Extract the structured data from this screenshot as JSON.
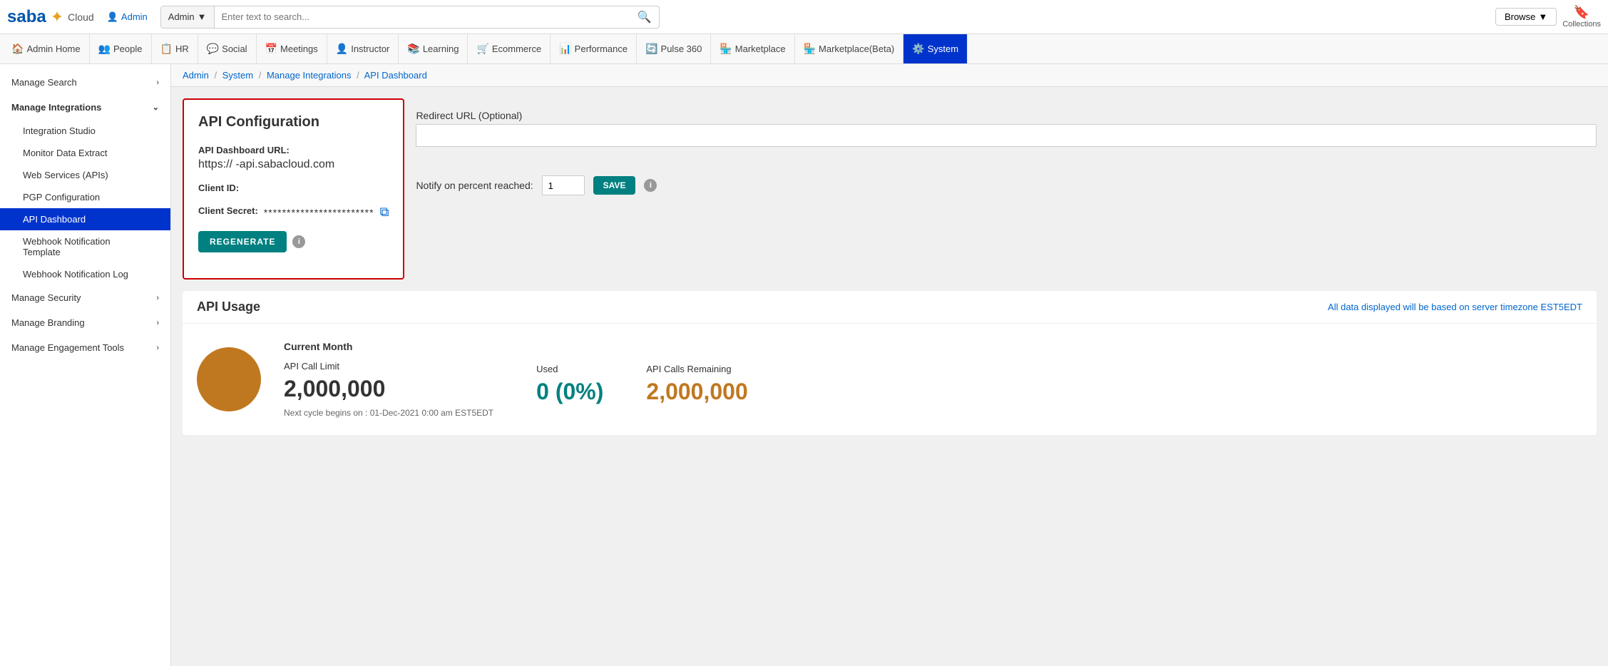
{
  "topbar": {
    "logo": "Saba Cloud",
    "admin_label": "Admin",
    "search_dropdown": "Admin",
    "search_placeholder": "Enter text to search...",
    "browse_label": "Browse",
    "collections_label": "Collections"
  },
  "navbar": {
    "items": [
      {
        "label": "Admin Home",
        "icon": "🏠",
        "active": false
      },
      {
        "label": "People",
        "icon": "👥",
        "active": false
      },
      {
        "label": "HR",
        "icon": "📋",
        "active": false
      },
      {
        "label": "Social",
        "icon": "💬",
        "active": false
      },
      {
        "label": "Meetings",
        "icon": "📅",
        "active": false
      },
      {
        "label": "Instructor",
        "icon": "👤",
        "active": false
      },
      {
        "label": "Learning",
        "icon": "📚",
        "active": false
      },
      {
        "label": "Ecommerce",
        "icon": "🛒",
        "active": false
      },
      {
        "label": "Performance",
        "icon": "📊",
        "active": false
      },
      {
        "label": "Pulse 360",
        "icon": "🔄",
        "active": false
      },
      {
        "label": "Marketplace",
        "icon": "🏪",
        "active": false
      },
      {
        "label": "Marketplace(Beta)",
        "icon": "🏪",
        "active": false
      },
      {
        "label": "System",
        "icon": "⚙️",
        "active": true
      }
    ]
  },
  "sidebar": {
    "items": [
      {
        "label": "Manage Search",
        "type": "parent",
        "expanded": false
      },
      {
        "label": "Manage Integrations",
        "type": "parent",
        "expanded": true
      },
      {
        "label": "Integration Studio",
        "type": "child",
        "active": false
      },
      {
        "label": "Monitor Data Extract",
        "type": "child",
        "active": false
      },
      {
        "label": "Web Services (APIs)",
        "type": "child",
        "active": false
      },
      {
        "label": "PGP Configuration",
        "type": "child",
        "active": false
      },
      {
        "label": "API Dashboard",
        "type": "child",
        "active": true
      },
      {
        "label": "Webhook Notification Template",
        "type": "child",
        "active": false
      },
      {
        "label": "Webhook Notification Log",
        "type": "child",
        "active": false
      },
      {
        "label": "Manage Security",
        "type": "parent",
        "expanded": false
      },
      {
        "label": "Manage Branding",
        "type": "parent",
        "expanded": false
      },
      {
        "label": "Manage Engagement Tools",
        "type": "parent",
        "expanded": false
      }
    ]
  },
  "breadcrumb": {
    "items": [
      "Admin",
      "System",
      "Manage Integrations"
    ],
    "current": "API Dashboard"
  },
  "api_config": {
    "title": "API Configuration",
    "url_label": "API Dashboard URL:",
    "url_value": "https://          -api.sabacloud.com",
    "client_id_label": "Client ID:",
    "client_secret_label": "Client Secret:",
    "client_secret_value": "************************",
    "regenerate_label": "REGENERATE"
  },
  "right_panel": {
    "redirect_label": "Redirect URL (Optional)",
    "redirect_placeholder": "",
    "notify_label": "Notify on percent reached:",
    "notify_value": "1",
    "save_label": "SAVE"
  },
  "api_usage": {
    "title": "API Usage",
    "timezone_note": "All data displayed will be based on server timezone EST5EDT",
    "current_month": "Current Month",
    "api_call_limit_label": "API Call Limit",
    "api_call_limit_value": "2,000,000",
    "used_label": "Used",
    "used_value": "0 (0%)",
    "remaining_label": "API Calls Remaining",
    "remaining_value": "2,000,000",
    "next_cycle": "Next cycle begins on : 01-Dec-2021 0:00 am EST5EDT"
  }
}
